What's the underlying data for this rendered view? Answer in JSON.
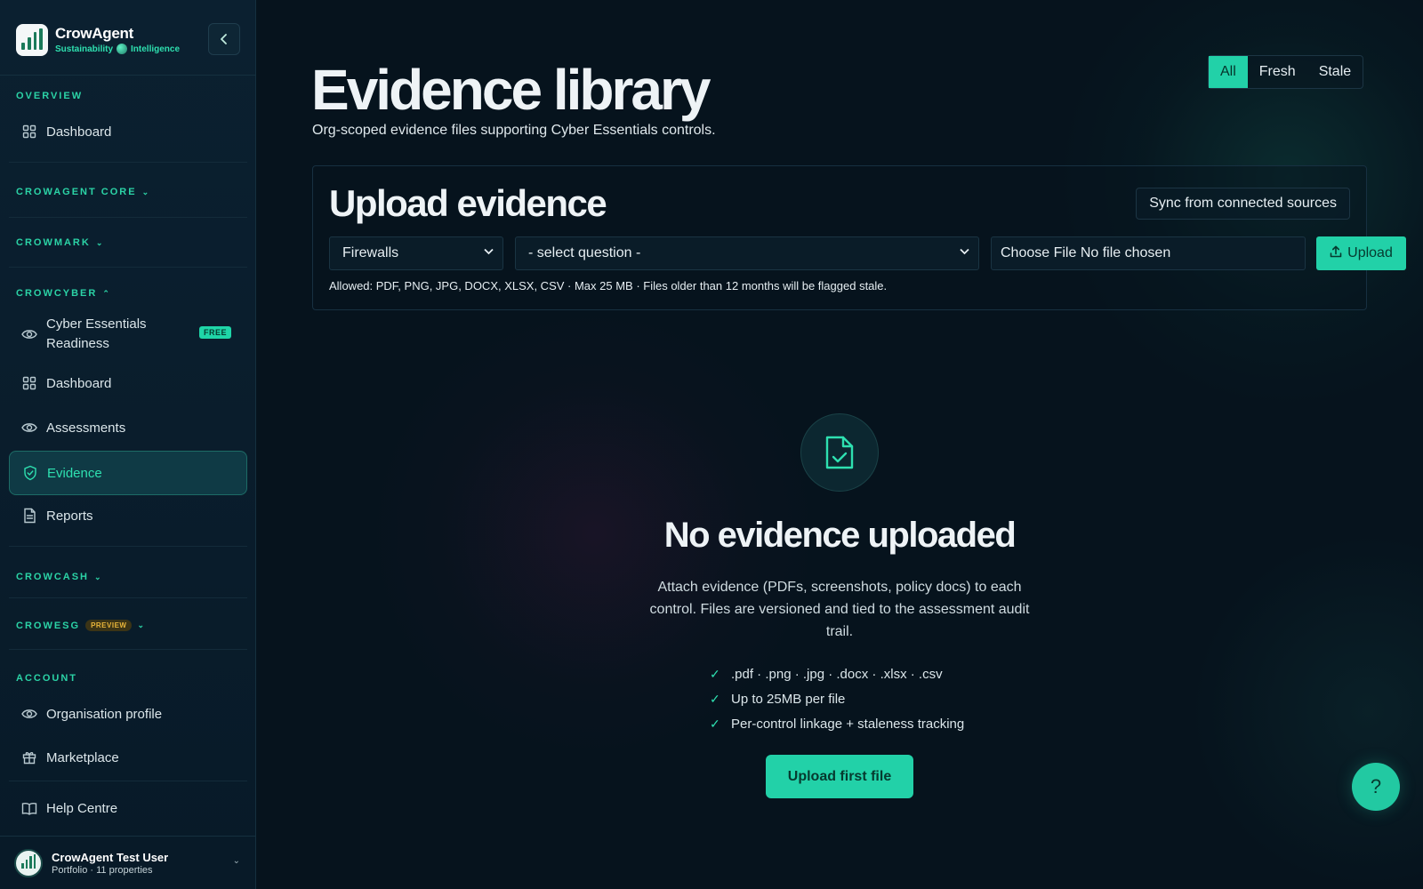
{
  "brand": {
    "name": "CrowAgent",
    "tagline_left": "Sustainability",
    "tagline_right": "Intelligence"
  },
  "sidebar": {
    "collapse_icon": "chevron-left-icon",
    "sections": {
      "overview": "OVERVIEW",
      "crowagent_core": "CROWAGENT CORE",
      "crowmark": "CROWMARK",
      "crowcyber": "CROWCYBER",
      "crowcash": "CROWCASH",
      "crowesg": "CROWESG",
      "crowesg_badge": "PREVIEW",
      "account": "ACCOUNT"
    },
    "items": {
      "dashboard_overview": "Dashboard",
      "cyber_essentials": "Cyber Essentials Readiness",
      "cyber_badge": "FREE",
      "dashboard_cyber": "Dashboard",
      "assessments": "Assessments",
      "evidence": "Evidence",
      "reports": "Reports",
      "org_profile": "Organisation profile",
      "marketplace": "Marketplace",
      "help_centre": "Help Centre"
    },
    "user": {
      "name": "CrowAgent Test User",
      "subtitle": "Portfolio · 11 properties"
    }
  },
  "main": {
    "title": "Evidence library",
    "subtitle": "Org-scoped evidence files supporting Cyber Essentials controls.",
    "filters": [
      "All",
      "Fresh",
      "Stale"
    ],
    "active_filter": "All",
    "upload": {
      "title": "Upload evidence",
      "sync_label": "Sync from connected sources",
      "control_select": "Firewalls",
      "question_select": "- select question -",
      "file_input": "Choose File No file chosen",
      "upload_label": "Upload",
      "allowed_text": "Allowed: PDF, PNG, JPG, DOCX, XLSX, CSV · Max 25 MB · Files older than 12 months will be flagged stale."
    },
    "empty": {
      "title": "No evidence uploaded",
      "description": "Attach evidence (PDFs, screenshots, policy docs) to each control. Files are versioned and tied to the assessment audit trail.",
      "checks": [
        ".pdf · .png · .jpg · .docx · .xlsx · .csv",
        "Up to 25MB per file",
        "Per-control linkage + staleness tracking"
      ],
      "cta": "Upload first file"
    },
    "help_fab": "?"
  },
  "colors": {
    "accent": "#22d1a8",
    "background": "#06131d",
    "sidebar": "#0b2030",
    "preview_badge": "#e8b53a"
  }
}
